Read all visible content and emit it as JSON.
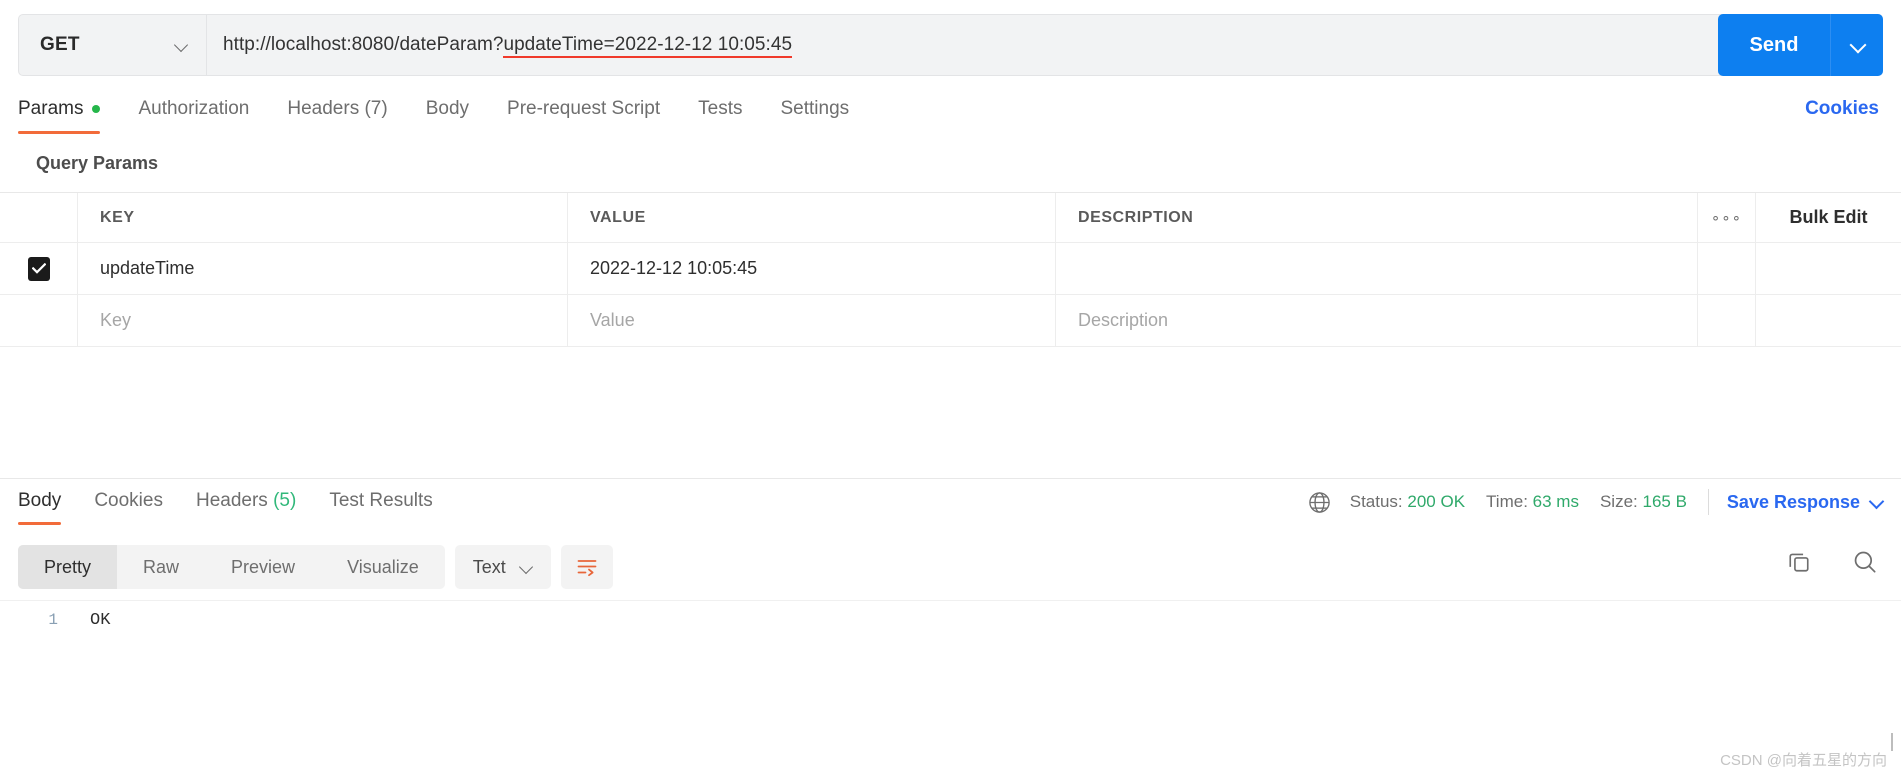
{
  "request": {
    "method": "GET",
    "url_full": "http://localhost:8080/dateParam?updateTime=2022-12-12 10:05:45",
    "url_base": "http://localhost:8080/dateParam?",
    "url_highlighted": "updateTime=2022-12-12 10:05:45",
    "send_label": "Send",
    "cookies_label": "Cookies",
    "tabs": [
      {
        "label": "Params",
        "active": true,
        "has_dot": true
      },
      {
        "label": "Authorization",
        "active": false,
        "has_dot": false
      },
      {
        "label": "Headers (7)",
        "active": false,
        "has_dot": false
      },
      {
        "label": "Body",
        "active": false,
        "has_dot": false
      },
      {
        "label": "Pre-request Script",
        "active": false,
        "has_dot": false
      },
      {
        "label": "Tests",
        "active": false,
        "has_dot": false
      },
      {
        "label": "Settings",
        "active": false,
        "has_dot": false
      }
    ]
  },
  "query_params": {
    "section_title": "Query Params",
    "columns": {
      "key": "KEY",
      "value": "VALUE",
      "description": "DESCRIPTION"
    },
    "more_icon": "∘∘∘",
    "bulk_edit_label": "Bulk Edit",
    "rows": [
      {
        "checked": true,
        "key": "updateTime",
        "value": "2022-12-12 10:05:45",
        "description": ""
      }
    ],
    "placeholder_row": {
      "key": "Key",
      "value": "Value",
      "description": "Description"
    }
  },
  "response": {
    "tabs": [
      {
        "label": "Body",
        "active": true
      },
      {
        "label": "Cookies",
        "active": false
      },
      {
        "label": "Headers",
        "active": false,
        "count": "(5)"
      },
      {
        "label": "Test Results",
        "active": false
      }
    ],
    "status": {
      "label": "Status:",
      "value": "200 OK"
    },
    "time": {
      "label": "Time:",
      "value": "63 ms"
    },
    "size": {
      "label": "Size:",
      "value": "165 B"
    },
    "save_response_label": "Save Response",
    "view_modes": [
      {
        "label": "Pretty",
        "active": true
      },
      {
        "label": "Raw",
        "active": false
      },
      {
        "label": "Preview",
        "active": false
      },
      {
        "label": "Visualize",
        "active": false
      }
    ],
    "format": "Text",
    "body_lines": [
      {
        "number": "1",
        "text": "OK"
      }
    ]
  },
  "watermark": "CSDN @向着五星的方向",
  "colors": {
    "accent_orange": "#f26b3a",
    "link_blue": "#2a68f0",
    "send_blue": "#0d7ff0",
    "status_green": "#2fa96a",
    "dot_green": "#25b64a",
    "underline_red": "#f03a2b"
  }
}
